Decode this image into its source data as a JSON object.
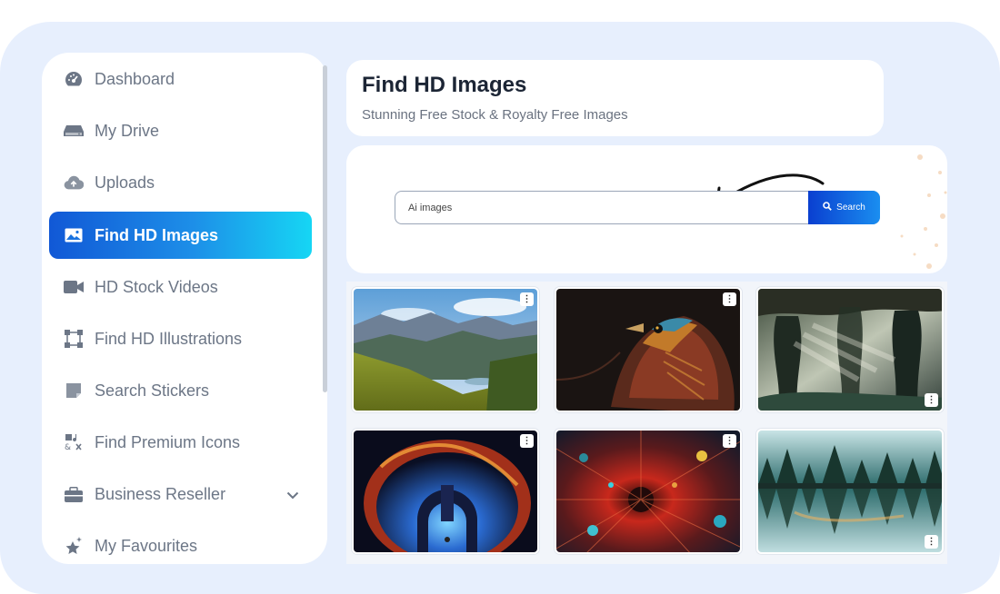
{
  "sidebar": {
    "items": [
      {
        "label": "Dashboard",
        "icon": "dashboard-gauge-icon"
      },
      {
        "label": "My Drive",
        "icon": "hard-drive-icon"
      },
      {
        "label": "Uploads",
        "icon": "cloud-upload-icon"
      },
      {
        "label": "Find HD Images",
        "icon": "image-icon",
        "active": true
      },
      {
        "label": "HD Stock Videos",
        "icon": "video-camera-icon"
      },
      {
        "label": "Find HD Illustrations",
        "icon": "vector-nodes-icon"
      },
      {
        "label": "Search Stickers",
        "icon": "sticker-icon"
      },
      {
        "label": "Find Premium Icons",
        "icon": "icon-set-icon"
      },
      {
        "label": "Business Reseller",
        "icon": "briefcase-icon",
        "has_dropdown": true
      },
      {
        "label": "My Favourites",
        "icon": "sparkle-star-icon"
      }
    ]
  },
  "header": {
    "title": "Find HD Images",
    "subtitle": "Stunning Free Stock & Royalty Free Images"
  },
  "search": {
    "value": "Ai images",
    "button_label": "Search",
    "button_icon": "search-icon"
  },
  "gallery": {
    "images": [
      {
        "subject": "mountain-valley-landscape",
        "menu_icon": "more-vertical-icon"
      },
      {
        "subject": "colorful-bird-portrait",
        "menu_icon": "more-vertical-icon"
      },
      {
        "subject": "misty-forest-cave",
        "menu_icon": "more-vertical-icon"
      },
      {
        "subject": "fiery-fantasy-portal",
        "menu_icon": "more-vertical-icon"
      },
      {
        "subject": "abstract-red-sphere",
        "menu_icon": "more-vertical-icon"
      },
      {
        "subject": "forest-lake-reflection",
        "menu_icon": "more-vertical-icon"
      }
    ]
  },
  "colors": {
    "frame_bg": "#e7effd",
    "active_gradient_start": "#1158d6",
    "active_gradient_end": "#16d6f4",
    "search_button": "#0a3fd0"
  }
}
